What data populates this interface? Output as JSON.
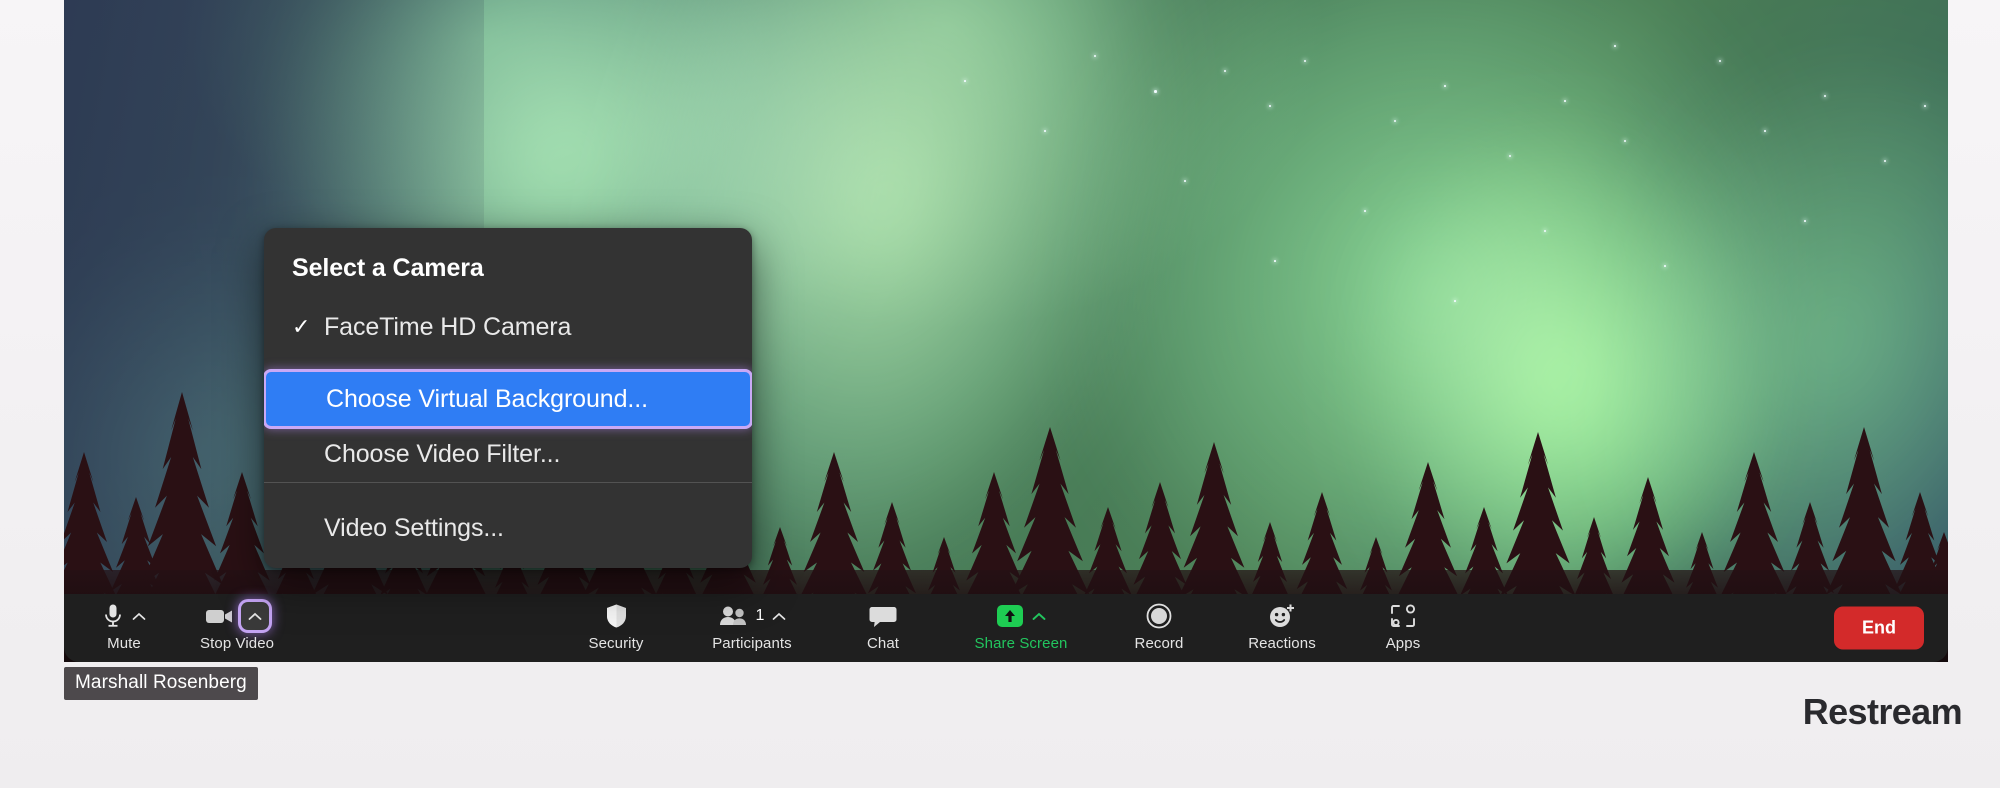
{
  "meeting": {
    "participant_name": "Marshall Rosenberg"
  },
  "camera_menu": {
    "header": "Select a Camera",
    "items": [
      {
        "label": "FaceTime HD Camera",
        "checked": true,
        "selected": false
      },
      {
        "label": "Choose Virtual Background...",
        "checked": false,
        "selected": true
      },
      {
        "label": "Choose Video Filter...",
        "checked": false,
        "selected": false
      },
      {
        "label": "Video Settings...",
        "checked": false,
        "selected": false
      }
    ],
    "highlight_color": "#2f7df4",
    "focus_ring_color": "#c9a9f5",
    "background_color": "#333333"
  },
  "toolbar": {
    "mute": {
      "label": "Mute",
      "icon": "microphone-icon"
    },
    "stop_video": {
      "label": "Stop Video",
      "icon": "camera-icon"
    },
    "security": {
      "label": "Security",
      "icon": "shield-icon"
    },
    "participants": {
      "label": "Participants",
      "icon": "people-icon",
      "count": "1"
    },
    "chat": {
      "label": "Chat",
      "icon": "speech-bubble-icon"
    },
    "share_screen": {
      "label": "Share Screen",
      "icon": "share-arrow-icon",
      "color": "#22c55e"
    },
    "record": {
      "label": "Record",
      "icon": "record-circle-icon"
    },
    "reactions": {
      "label": "Reactions",
      "icon": "smiley-plus-icon"
    },
    "apps": {
      "label": "Apps",
      "icon": "apps-icon"
    },
    "end": {
      "label": "End",
      "color": "#d32a2a"
    }
  },
  "watermark": {
    "text": "Restream"
  }
}
